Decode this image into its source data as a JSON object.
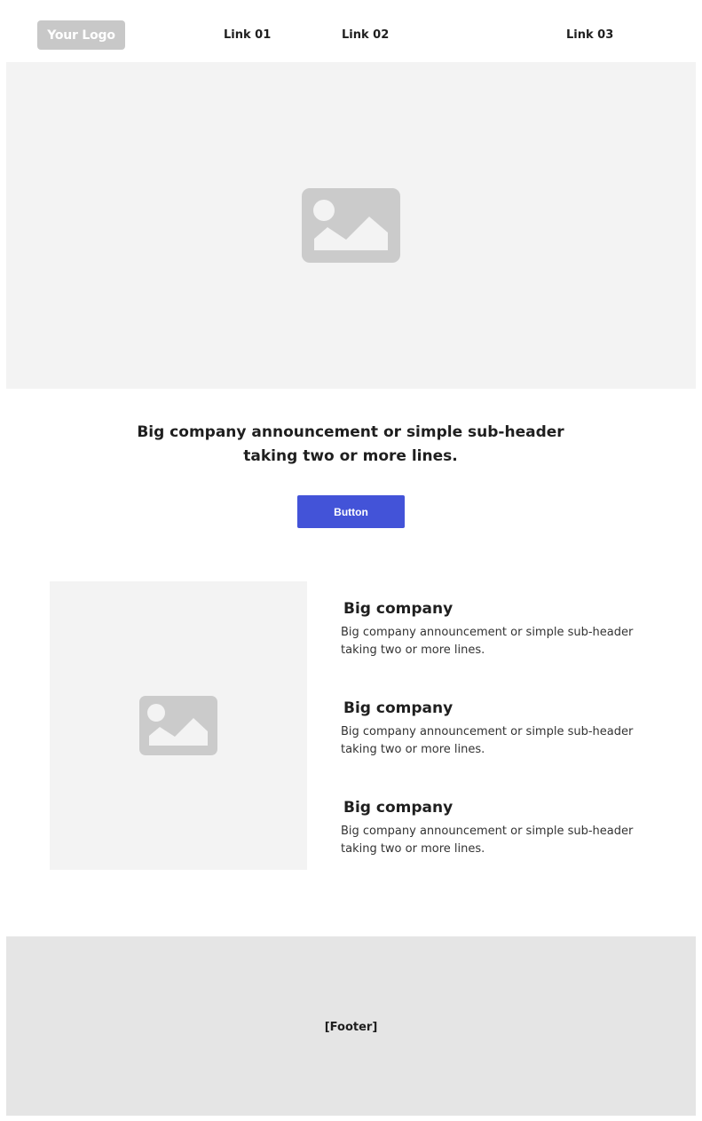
{
  "header": {
    "logo_text": "Your Logo",
    "links": [
      "Link 01",
      "Link 02",
      "Link 03"
    ]
  },
  "hero": {
    "image_icon": "image-placeholder-icon"
  },
  "announcement": {
    "line1": "Big company announcement or simple sub-header",
    "line2": "taking two or more lines.",
    "button_label": "Button"
  },
  "features": [
    {
      "title": "Big company",
      "text_line1": "Big company announcement or simple sub-header",
      "text_line2": "taking two or more lines."
    },
    {
      "title": "Big company",
      "text_line1": "Big company announcement or simple sub-header",
      "text_line2": "taking two or more lines."
    },
    {
      "title": "Big company",
      "text_line1": "Big company announcement or simple sub-header",
      "text_line2": "taking two or more lines."
    }
  ],
  "footer": {
    "label": "[Footer]"
  },
  "colors": {
    "accent": "#4353d8",
    "placeholder_bg": "#f3f3f3",
    "placeholder_icon": "#cbcbcb",
    "footer_bg": "#e5e5e5",
    "logo_bg": "#c8c8c8"
  }
}
